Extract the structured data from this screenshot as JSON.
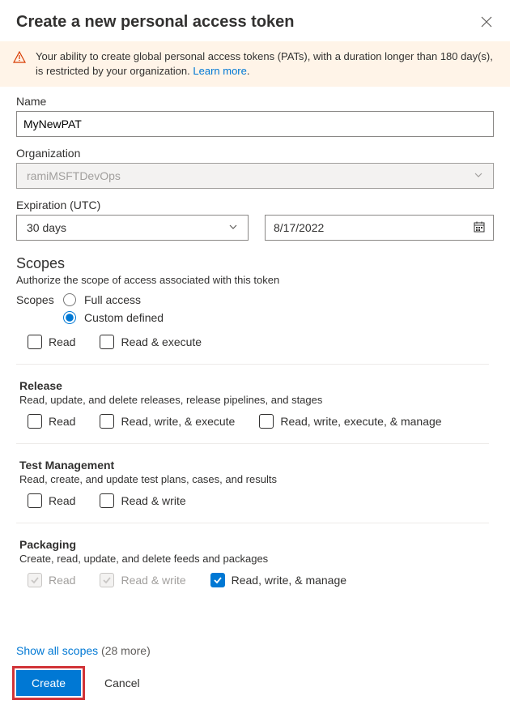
{
  "header": {
    "title": "Create a new personal access token"
  },
  "warning": {
    "text_before": "Your ability to create global personal access tokens (PATs), with a duration longer than 180 day(s), is restricted by your organization. ",
    "link_text": "Learn more",
    "tail": "."
  },
  "fields": {
    "name_label": "Name",
    "name_value": "MyNewPAT",
    "org_label": "Organization",
    "org_value": "ramiMSFTDevOps",
    "exp_label": "Expiration (UTC)",
    "exp_select": "30 days",
    "exp_date": "8/17/2022"
  },
  "scopes": {
    "heading": "Scopes",
    "subtitle": "Authorize the scope of access associated with this token",
    "radio_label": "Scopes",
    "full_access": "Full access",
    "custom": "Custom defined",
    "groups": {
      "prev": {
        "perms": {
          "read": "Read",
          "execute": "Read & execute"
        }
      },
      "release": {
        "title": "Release",
        "desc": "Read, update, and delete releases, release pipelines, and stages",
        "perms": {
          "read": "Read",
          "rwe": "Read, write, & execute",
          "rwem": "Read, write, execute, & manage"
        }
      },
      "test": {
        "title": "Test Management",
        "desc": "Read, create, and update test plans, cases, and results",
        "perms": {
          "read": "Read",
          "rw": "Read & write"
        }
      },
      "packaging": {
        "title": "Packaging",
        "desc": "Create, read, update, and delete feeds and packages",
        "perms": {
          "read": "Read",
          "rw": "Read & write",
          "rwm": "Read, write, & manage"
        }
      }
    }
  },
  "footer": {
    "show_all": "Show all scopes",
    "count_suffix": " (28 more)",
    "create": "Create",
    "cancel": "Cancel"
  }
}
